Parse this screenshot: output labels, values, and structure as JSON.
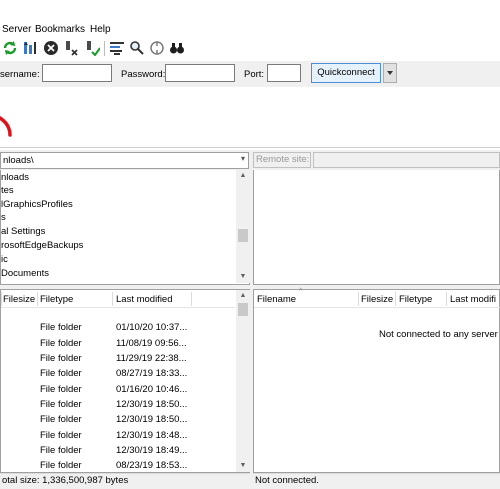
{
  "menu": [
    "Server",
    "Bookmarks",
    "Help"
  ],
  "toolbar_icons": [
    "refresh-icon",
    "process-queue-icon",
    "cancel-icon",
    "disconnect-icon",
    "reconnect-icon",
    "filter-icon",
    "compare-icon",
    "sync-browse-icon",
    "search-icon"
  ],
  "quickconnect": {
    "username_label": "sername:",
    "password_label": "Password:",
    "port_label": "Port:",
    "button_label": "Quickconnect",
    "username_value": "",
    "password_value": "",
    "port_value": ""
  },
  "local": {
    "path": "nloads\\",
    "tree": [
      "nloads",
      "tes",
      "lGraphicsProfiles",
      "s",
      "al Settings",
      "rosoftEdgeBackups",
      "ic",
      "Documents"
    ],
    "columns": [
      "Filesize",
      "Filetype",
      "Last modified"
    ],
    "rows": [
      {
        "type": "File folder",
        "modified": "01/10/20 10:37..."
      },
      {
        "type": "File folder",
        "modified": "11/08/19 09:56..."
      },
      {
        "type": "File folder",
        "modified": "11/29/19 22:38..."
      },
      {
        "type": "File folder",
        "modified": "08/27/19 18:33..."
      },
      {
        "type": "File folder",
        "modified": "01/16/20 10:46..."
      },
      {
        "type": "File folder",
        "modified": "12/30/19 18:50..."
      },
      {
        "type": "File folder",
        "modified": "12/30/19 18:50..."
      },
      {
        "type": "File folder",
        "modified": "12/30/19 18:48..."
      },
      {
        "type": "File folder",
        "modified": "12/30/19 18:49..."
      },
      {
        "type": "File folder",
        "modified": "08/23/19 18:53..."
      }
    ],
    "status": "otal size: 1,336,500,987 bytes"
  },
  "remote": {
    "site_label": "Remote site:",
    "columns": [
      "Filename",
      "Filesize",
      "Filetype",
      "Last modifi"
    ],
    "empty_message": "Not connected to any server",
    "status": "Not connected."
  },
  "colors": {
    "accent": "#4c8fd6",
    "annotation": "#d9141a"
  }
}
